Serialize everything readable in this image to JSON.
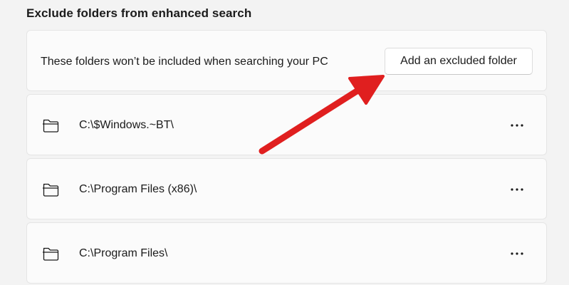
{
  "section": {
    "title": "Exclude folders from enhanced search"
  },
  "header_card": {
    "description": "These folders won’t be included when searching your PC",
    "add_button_label": "Add an excluded folder"
  },
  "folders": [
    {
      "path": "C:\\$Windows.~BT\\",
      "more_icon": "more-options-icon"
    },
    {
      "path": "C:\\Program Files (x86)\\",
      "more_icon": "more-options-icon"
    },
    {
      "path": "C:\\Program Files\\",
      "more_icon": "more-options-icon"
    }
  ],
  "annotation": {
    "arrow_color": "#e01f1f"
  }
}
